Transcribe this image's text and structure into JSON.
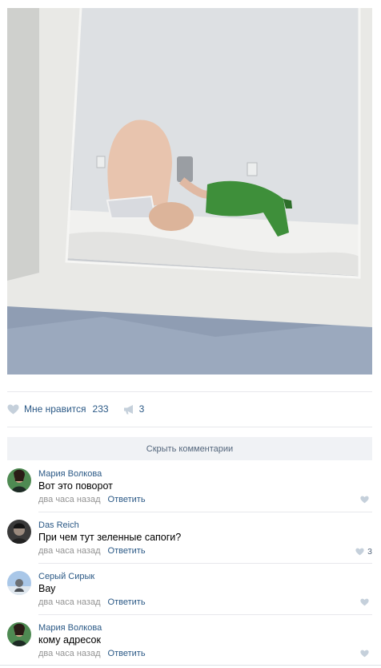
{
  "post": {
    "like_label": "Мне нравится",
    "like_count": "233",
    "share_count": "3",
    "icons": {
      "like": "heart-icon",
      "share": "megaphone-icon"
    }
  },
  "comments_toggle": {
    "label": "Скрыть комментарии"
  },
  "comments": [
    {
      "author": "Мария Волкова",
      "text": "Вот это поворот",
      "time": "два часа назад",
      "reply": "Ответить",
      "likes": ""
    },
    {
      "author": "Das Reich",
      "text": "При чем тут зеленные сапоги?",
      "time": "два часа назад",
      "reply": "Ответить",
      "likes": "3"
    },
    {
      "author": "Серый Сирык",
      "text": "Вау",
      "time": "два часа назад",
      "reply": "Ответить",
      "likes": ""
    },
    {
      "author": "Мария Волкова",
      "text": "кому адресок",
      "time": "два часа назад",
      "reply": "Ответить",
      "likes": ""
    }
  ],
  "colors": {
    "link": "#2a5885",
    "meta": "#939393",
    "toggle_bg": "#f0f2f5"
  }
}
